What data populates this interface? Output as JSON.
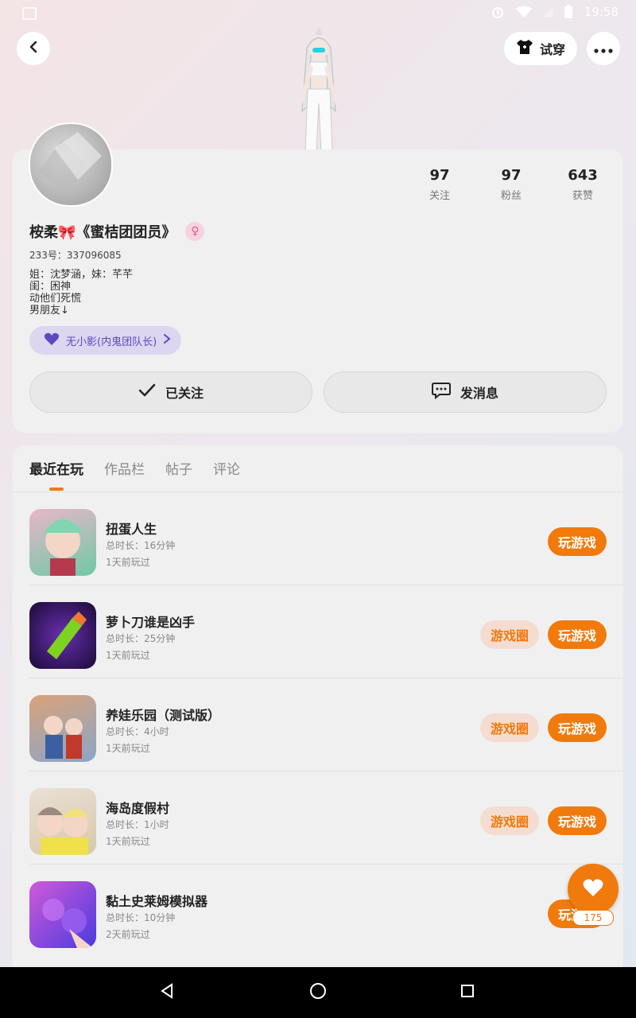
{
  "status": {
    "time": "19:58"
  },
  "header": {
    "tryon_label": "试穿"
  },
  "profile": {
    "nickname": "桉柔🎀《蜜桔团团员》",
    "gender_symbol": "♀",
    "uid": "233号：337096085",
    "bio": [
      "姐：沈梦涵，妹：芊芊",
      "闺：困神",
      "动他们死慌",
      "男朋友↓"
    ],
    "guild_label": "无小影(内鬼团队长)",
    "stats": [
      {
        "num": "97",
        "label": "关注"
      },
      {
        "num": "97",
        "label": "粉丝"
      },
      {
        "num": "643",
        "label": "获赞"
      }
    ],
    "follow_label": "已关注",
    "message_label": "发消息"
  },
  "tabs": [
    "最近在玩",
    "作品栏",
    "帖子",
    "评论"
  ],
  "games": [
    {
      "title": "扭蛋人生",
      "duration": "总时长：16分钟",
      "last_played": "1天前玩过",
      "play_label": "玩游戏",
      "has_circle": false,
      "icon_colors": [
        "#e8b6c8",
        "#6fc9a6"
      ]
    },
    {
      "title": "萝卜刀谁是凶手",
      "duration": "总时长：25分钟",
      "last_played": "1天前玩过",
      "play_label": "玩游戏",
      "circle_label": "游戏圈",
      "has_circle": true,
      "icon_colors": [
        "#2a1550",
        "#7ed321"
      ]
    },
    {
      "title": "养娃乐园（测试版）",
      "duration": "总时长：4小时",
      "last_played": "1天前玩过",
      "play_label": "玩游戏",
      "circle_label": "游戏圈",
      "has_circle": true,
      "icon_colors": [
        "#c98a5a",
        "#6b8db7"
      ]
    },
    {
      "title": "海岛度假村",
      "duration": "总时长：1小时",
      "last_played": "1天前玩过",
      "play_label": "玩游戏",
      "circle_label": "游戏圈",
      "has_circle": true,
      "icon_colors": [
        "#cfc0b0",
        "#f2e27a"
      ]
    },
    {
      "title": "黏土史莱姆模拟器",
      "duration": "总时长：10分钟",
      "last_played": "2天前玩过",
      "play_label": "玩游戏",
      "has_circle": false,
      "icon_colors": [
        "#b347d8",
        "#3a55e0"
      ]
    }
  ],
  "fab": {
    "count": "175"
  }
}
